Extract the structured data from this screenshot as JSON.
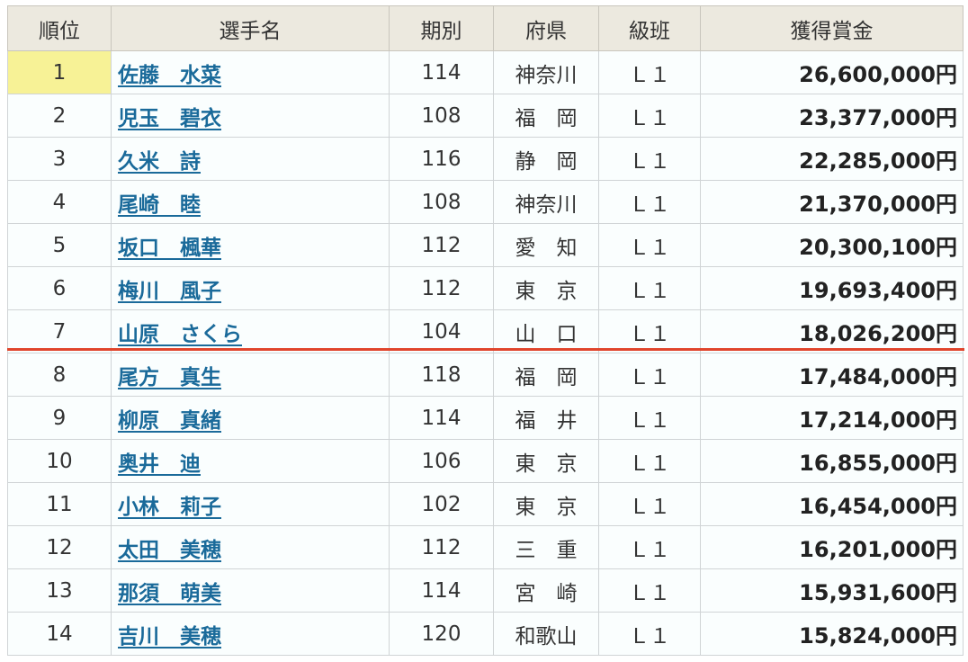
{
  "headers": [
    "順位",
    "選手名",
    "期別",
    "府県",
    "級班",
    "獲得賞金"
  ],
  "rows": [
    {
      "rank": "1",
      "name": "佐藤　水菜",
      "term": "114",
      "pref": "神奈川",
      "class": "Ｌ１",
      "prize": "26,600,000円"
    },
    {
      "rank": "2",
      "name": "児玉　碧衣",
      "term": "108",
      "pref": "福　岡",
      "class": "Ｌ１",
      "prize": "23,377,000円"
    },
    {
      "rank": "3",
      "name": "久米　詩",
      "term": "116",
      "pref": "静　岡",
      "class": "Ｌ１",
      "prize": "22,285,000円"
    },
    {
      "rank": "4",
      "name": "尾崎　睦",
      "term": "108",
      "pref": "神奈川",
      "class": "Ｌ１",
      "prize": "21,370,000円"
    },
    {
      "rank": "5",
      "name": "坂口　楓華",
      "term": "112",
      "pref": "愛　知",
      "class": "Ｌ１",
      "prize": "20,300,100円"
    },
    {
      "rank": "6",
      "name": "梅川　風子",
      "term": "112",
      "pref": "東　京",
      "class": "Ｌ１",
      "prize": "19,693,400円"
    },
    {
      "rank": "7",
      "name": "山原　さくら",
      "term": "104",
      "pref": "山　口",
      "class": "Ｌ１",
      "prize": "18,026,200円"
    },
    {
      "rank": "8",
      "name": "尾方　真生",
      "term": "118",
      "pref": "福　岡",
      "class": "Ｌ１",
      "prize": "17,484,000円"
    },
    {
      "rank": "9",
      "name": "柳原　真緒",
      "term": "114",
      "pref": "福　井",
      "class": "Ｌ１",
      "prize": "17,214,000円"
    },
    {
      "rank": "10",
      "name": "奥井　迪",
      "term": "106",
      "pref": "東　京",
      "class": "Ｌ１",
      "prize": "16,855,000円"
    },
    {
      "rank": "11",
      "name": "小林　莉子",
      "term": "102",
      "pref": "東　京",
      "class": "Ｌ１",
      "prize": "16,454,000円"
    },
    {
      "rank": "12",
      "name": "太田　美穂",
      "term": "112",
      "pref": "三　重",
      "class": "Ｌ１",
      "prize": "16,201,000円"
    },
    {
      "rank": "13",
      "name": "那須　萌美",
      "term": "114",
      "pref": "宮　崎",
      "class": "Ｌ１",
      "prize": "15,931,600円"
    },
    {
      "rank": "14",
      "name": "吉川　美穂",
      "term": "120",
      "pref": "和歌山",
      "class": "Ｌ１",
      "prize": "15,824,000円"
    }
  ],
  "colors": {
    "header_bg": "#ece9df",
    "highlight": "#f7f296",
    "link": "#1a6a9a",
    "cut_line": "#e0452c"
  }
}
